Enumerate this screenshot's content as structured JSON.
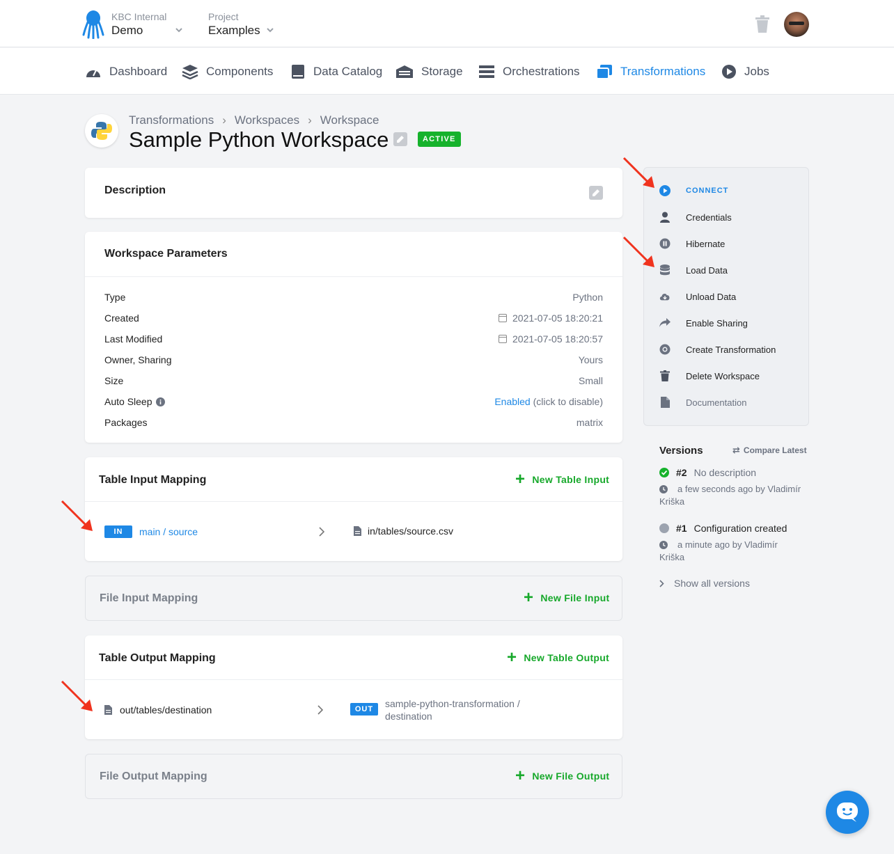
{
  "header": {
    "org_label": "KBC Internal",
    "org_value": "Demo",
    "project_label": "Project",
    "project_value": "Examples"
  },
  "nav": {
    "items": [
      {
        "label": "Dashboard",
        "icon": "gauge-icon"
      },
      {
        "label": "Components",
        "icon": "layers-icon"
      },
      {
        "label": "Data Catalog",
        "icon": "book-icon"
      },
      {
        "label": "Storage",
        "icon": "warehouse-icon"
      },
      {
        "label": "Orchestrations",
        "icon": "bars-icon"
      },
      {
        "label": "Transformations",
        "icon": "window-icon",
        "active": true
      },
      {
        "label": "Jobs",
        "icon": "play-circle-icon"
      }
    ]
  },
  "page": {
    "breadcrumb": [
      "Transformations",
      "Workspaces",
      "Workspace"
    ],
    "title": "Sample Python Workspace",
    "status": "ACTIVE"
  },
  "description": {
    "title": "Description"
  },
  "params": {
    "title": "Workspace Parameters",
    "rows": [
      {
        "key": "Type",
        "value": "Python"
      },
      {
        "key": "Created",
        "value": "2021-07-05 18:20:21"
      },
      {
        "key": "Last Modified",
        "value": "2021-07-05 18:20:57"
      },
      {
        "key": "Owner, Sharing",
        "value": "Yours"
      },
      {
        "key": "Size",
        "value": "Small"
      },
      {
        "key": "Auto Sleep",
        "value_link": "Enabled",
        "value_rest": "(click to disable)"
      },
      {
        "key": "Packages",
        "value": "matrix"
      }
    ]
  },
  "table_input": {
    "title": "Table Input Mapping",
    "add_label": "New Table Input",
    "tag": "IN",
    "source": "main / source",
    "dest": "in/tables/source.csv"
  },
  "file_input": {
    "title": "File Input Mapping",
    "add_label": "New File Input"
  },
  "table_output": {
    "title": "Table Output Mapping",
    "add_label": "New Table Output",
    "source": "out/tables/destination",
    "tag": "OUT",
    "dest_line1": "sample-python-transformation /",
    "dest_line2": "destination"
  },
  "file_output": {
    "title": "File Output Mapping",
    "add_label": "New File Output"
  },
  "sidebar": {
    "items": [
      {
        "label": "CONNECT",
        "icon": "play-circle-icon"
      },
      {
        "label": "Credentials",
        "icon": "user-icon"
      },
      {
        "label": "Hibernate",
        "icon": "pause-circle-icon"
      },
      {
        "label": "Load Data",
        "icon": "database-icon"
      },
      {
        "label": "Unload Data",
        "icon": "cloud-download-icon"
      },
      {
        "label": "Enable Sharing",
        "icon": "share-icon"
      },
      {
        "label": "Create Transformation",
        "icon": "gear-icon"
      },
      {
        "label": "Delete Workspace",
        "icon": "trash-icon"
      },
      {
        "label": "Documentation",
        "icon": "file-icon"
      }
    ]
  },
  "versions": {
    "title": "Versions",
    "compare_label": "Compare Latest",
    "list": [
      {
        "num": "#2",
        "desc": "No description",
        "time_line1": "a few seconds ago by Vladimír",
        "time_line2": "Kriška",
        "status_color": "#16b22c"
      },
      {
        "num": "#1",
        "desc": "Configuration created",
        "time_line1": "a minute ago by Vladimír",
        "time_line2": "Kriška",
        "status_color": "#9ca3af"
      }
    ],
    "show_all": "Show all versions"
  },
  "colors": {
    "accent": "#1e88e5",
    "success": "#16b22c",
    "annotation": "#f0331e"
  }
}
